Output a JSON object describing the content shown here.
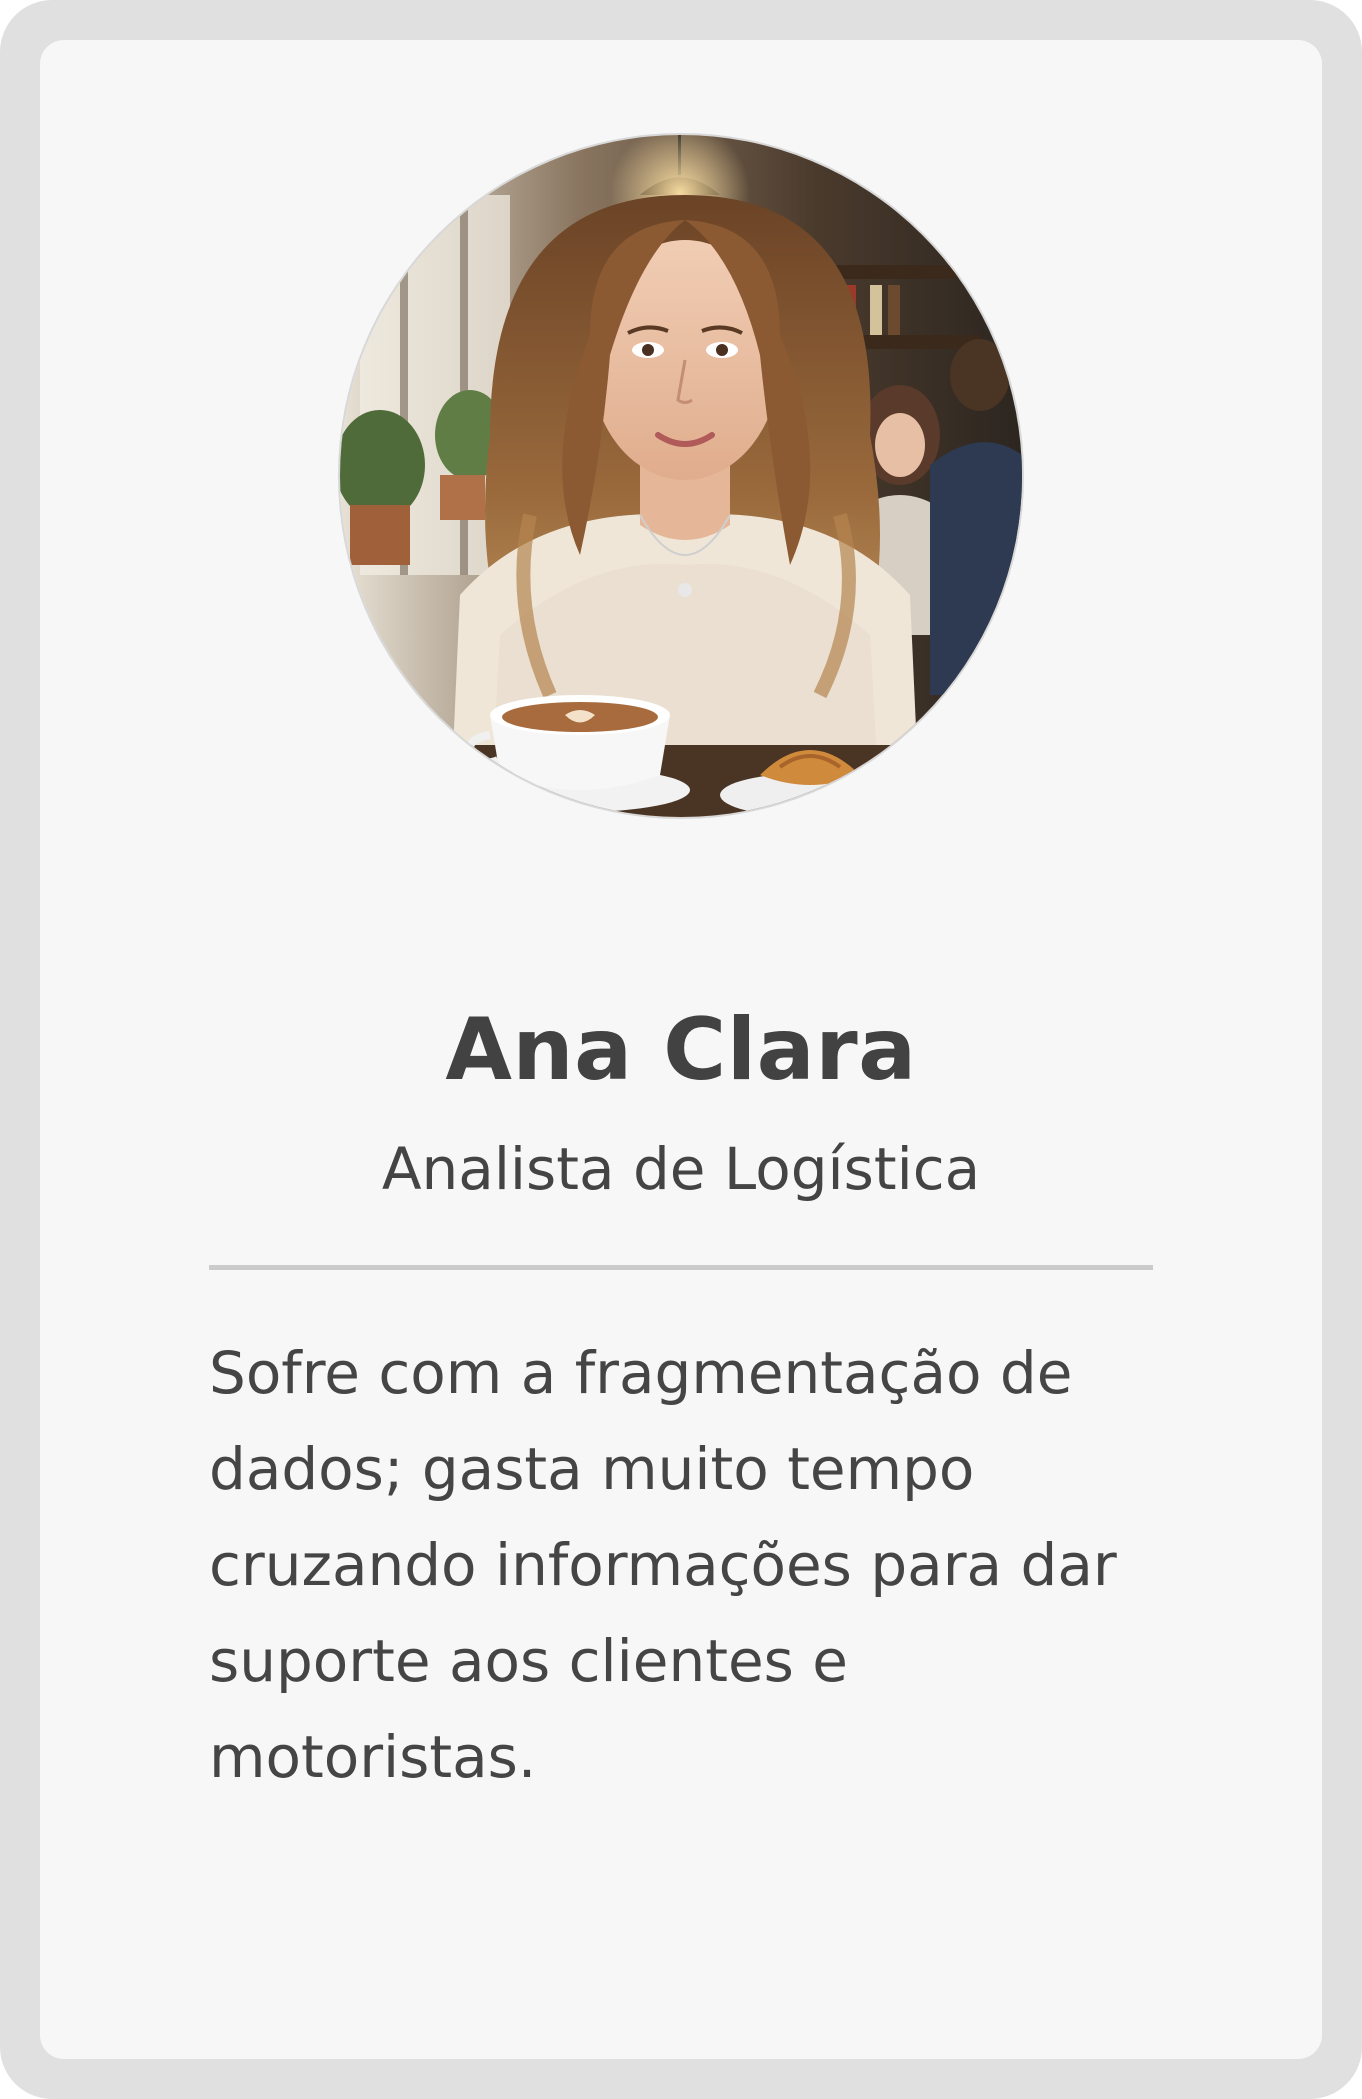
{
  "persona": {
    "name": "Ana Clara",
    "role": "Analista de Logística",
    "description": "Sofre com a fragmentação de dados; gasta muito tempo cruzando informações para dar suporte aos clientes e motoristas.",
    "photo_icon": "person-photo"
  },
  "colors": {
    "frame": "#e0e0e0",
    "card": "#f7f7f7",
    "text": "#424242",
    "divider": "#cbcbcb"
  }
}
